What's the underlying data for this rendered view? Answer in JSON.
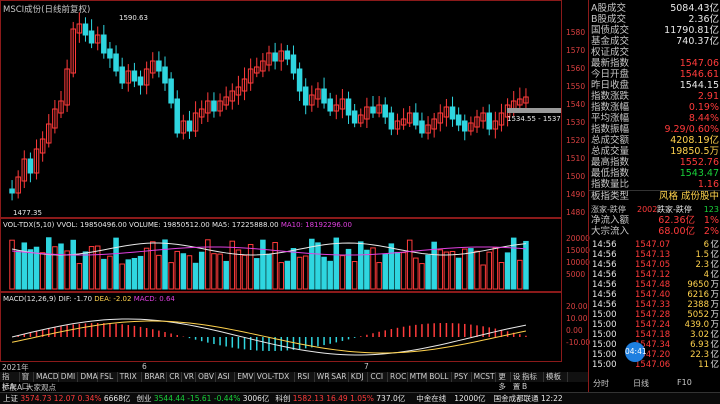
{
  "chart_title": "MSCI成份(日线前复权)",
  "price_chart": {
    "y_ticks": [
      "1580",
      "1570",
      "1560",
      "1550",
      "1540",
      "1530",
      "1520",
      "1510",
      "1500",
      "1490",
      "1480"
    ],
    "high_label": "1590.63",
    "low_label": "1477.35",
    "last_range": "1534.55 - 1537.10"
  },
  "volume_chart": {
    "legend": {
      "title": "VOL-TDX(5,10)",
      "vvol": "VVOL: 19850496.00",
      "volume": "VOLUME: 19850512.00",
      "ma5": "MA5: 17225888.00",
      "ma10": "MA10: 18192296.00"
    },
    "y_ticks": [
      "20000",
      "15000",
      "10000",
      "5000"
    ]
  },
  "macd_chart": {
    "legend": {
      "title": "MACD(12,26,9)",
      "dif": "DIF: -1.70",
      "dea": "DEA: -2.02",
      "macd": "MACD: 0.64"
    },
    "y_ticks": [
      "20.00",
      "10.00",
      "0.00",
      "-10.00"
    ]
  },
  "date_axis": [
    "2021年",
    "6",
    "7"
  ],
  "indicator_tabs": [
    "指标A",
    "窗口",
    "MACD",
    "DMI",
    "DMA",
    "FSL",
    "TRIX",
    "BRAR",
    "CR",
    "VR",
    "OBV",
    "ASI",
    "EMV",
    "VOL-TDX",
    "RSI",
    "WR",
    "SAR",
    "KDJ",
    "CCI",
    "ROC",
    "MTM",
    "BOLL",
    "PSY",
    "MCST",
    "更多",
    "设置"
  ],
  "right_tabs": [
    "指标B",
    "模板"
  ],
  "extra_row": [
    "扩展A",
    "大家观点"
  ],
  "quote": {
    "rows": [
      {
        "label": "A股成交",
        "value": "5084.43亿",
        "c": "wht"
      },
      {
        "label": "B股成交",
        "value": "2.36亿",
        "c": "wht"
      },
      {
        "label": "国债成交",
        "value": "11790.81亿",
        "c": "wht"
      },
      {
        "label": "基金成交",
        "value": "740.37亿",
        "c": "wht"
      },
      {
        "label": "权证成交",
        "value": "",
        "c": "wht"
      },
      {
        "label": "最新指数",
        "value": "1547.06",
        "c": "red"
      },
      {
        "label": "今日开盘",
        "value": "1546.61",
        "c": "red"
      },
      {
        "label": "昨日收盘",
        "value": "1544.15",
        "c": "wht"
      },
      {
        "label": "指数涨跌",
        "value": "2.91",
        "c": "red"
      },
      {
        "label": "指数涨幅",
        "value": "0.19%",
        "c": "red"
      },
      {
        "label": "平均涨幅",
        "value": "8.44%",
        "c": "red"
      },
      {
        "label": "指数振幅",
        "value": "9.29/0.60%",
        "c": "red"
      },
      {
        "label": "总成交额",
        "value": "4208.19亿",
        "c": "yel"
      },
      {
        "label": "总成交量",
        "value": "19850.5万",
        "c": "yel"
      },
      {
        "label": "最高指数",
        "value": "1552.76",
        "c": "red"
      },
      {
        "label": "最低指数",
        "value": "1543.47",
        "c": "grn"
      },
      {
        "label": "指数量比",
        "value": "1.16",
        "c": "red"
      },
      {
        "label": "板指类型",
        "value": "风格 成份股中",
        "c": "yel"
      }
    ],
    "updown": {
      "label": "涨家-跌停",
      "v1": "2002",
      "v2": "跌家-跌停",
      "v3": "123"
    },
    "flows": [
      {
        "label": "净流入额",
        "value": "62.36亿",
        "pct": "1%"
      },
      {
        "label": "大宗流入",
        "value": "68.00亿",
        "pct": "2%"
      }
    ]
  },
  "ticks": [
    {
      "time": "14:56",
      "price": "1547.07",
      "vol": "6",
      "unit": "亿",
      "pc": "red"
    },
    {
      "time": "14:56",
      "price": "1547.13",
      "vol": "1.5",
      "unit": "亿",
      "pc": "red"
    },
    {
      "time": "14:56",
      "price": "1547.05",
      "vol": "2.3",
      "unit": "亿",
      "pc": "red"
    },
    {
      "time": "14:56",
      "price": "1547.12",
      "vol": "4",
      "unit": "亿",
      "pc": "red"
    },
    {
      "time": "14:56",
      "price": "1547.48",
      "vol": "9650",
      "unit": "万",
      "pc": "red"
    },
    {
      "time": "14:56",
      "price": "1547.40",
      "vol": "6216",
      "unit": "万",
      "pc": "red"
    },
    {
      "time": "14:56",
      "price": "1547.33",
      "vol": "2388",
      "unit": "万",
      "pc": "red"
    },
    {
      "time": "15:00",
      "price": "1547.28",
      "vol": "5052",
      "unit": "万",
      "pc": "red"
    },
    {
      "time": "15:00",
      "price": "1547.24",
      "vol": "439.0",
      "unit": "万",
      "pc": "red"
    },
    {
      "time": "15:00",
      "price": "1547.18",
      "vol": "3.02",
      "unit": "亿",
      "pc": "red"
    },
    {
      "time": "15:00",
      "price": "1547.34",
      "vol": "6.93",
      "unit": "亿",
      "pc": "red"
    },
    {
      "time": "15:00",
      "price": "1547.20",
      "vol": "22.3",
      "unit": "亿",
      "pc": "red"
    },
    {
      "time": "15:00",
      "price": "1547.06",
      "vol": "11",
      "unit": "亿",
      "pc": "red"
    }
  ],
  "clock": "04:41",
  "bottom_tabs": [
    "分时",
    "日线",
    "F10"
  ],
  "status": {
    "items": [
      {
        "name": "上证",
        "val": "3574.73",
        "chg": "12.07",
        "pct": "0.34%",
        "amt": "6668亿",
        "c": "red"
      },
      {
        "name": "创业",
        "val": "3544.44",
        "chg": "-15.61",
        "pct": "-0.44%",
        "amt": "3006亿",
        "c": "grn"
      },
      {
        "name": "科创",
        "val": "1582.13",
        "chg": "16.49",
        "pct": "1.05%",
        "amt": "737.0亿",
        "c": "red"
      }
    ],
    "right": [
      "中金在线",
      "12000亿",
      "国金成都联通 12:22"
    ]
  }
}
